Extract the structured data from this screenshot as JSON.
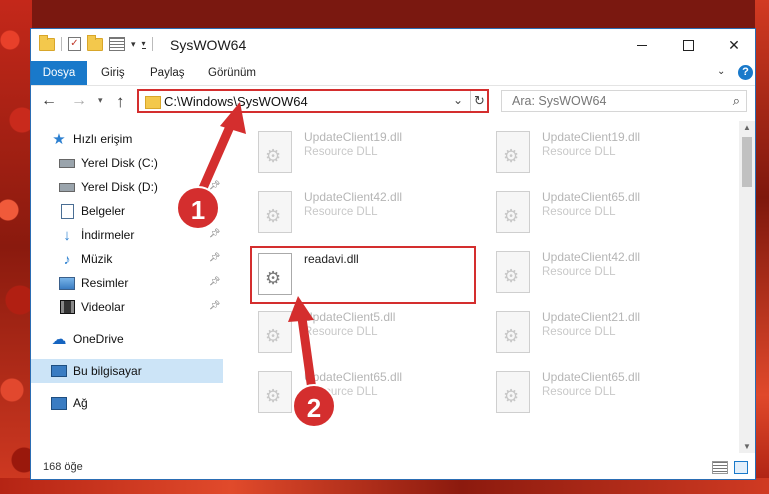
{
  "window": {
    "title": "SysWOW64",
    "ribbon_tabs": [
      "Dosya",
      "Giriş",
      "Paylaş",
      "Görünüm"
    ],
    "help": "?"
  },
  "address": {
    "path": "C:\\Windows\\SysWOW64",
    "search_placeholder": "Ara: SysWOW64"
  },
  "nav": {
    "items": [
      {
        "label": "Hızlı erişim",
        "icon": "star-icon",
        "pinned": false
      },
      {
        "label": "Yerel Disk (C:)",
        "icon": "drive-icon",
        "pinned": true
      },
      {
        "label": "Yerel Disk (D:)",
        "icon": "drive-icon",
        "pinned": true
      },
      {
        "label": "Belgeler",
        "icon": "documents-icon",
        "pinned": true
      },
      {
        "label": "İndirmeler",
        "icon": "downloads-icon",
        "pinned": true
      },
      {
        "label": "Müzik",
        "icon": "music-icon",
        "pinned": true
      },
      {
        "label": "Resimler",
        "icon": "pictures-icon",
        "pinned": true
      },
      {
        "label": "Videolar",
        "icon": "videos-icon",
        "pinned": true
      },
      {
        "label": "OneDrive",
        "icon": "onedrive-icon",
        "pinned": false
      },
      {
        "label": "Bu bilgisayar",
        "icon": "this-pc-icon",
        "pinned": false
      },
      {
        "label": "Ağ",
        "icon": "network-icon",
        "pinned": false
      }
    ]
  },
  "files": [
    {
      "name": "UpdateClient19.dll",
      "desc": "Resource DLL"
    },
    {
      "name": "UpdateClient19.dll",
      "desc": "Resource DLL"
    },
    {
      "name": "UpdateClient42.dll",
      "desc": "Resource DLL"
    },
    {
      "name": "UpdateClient65.dll",
      "desc": "Resource DLL"
    },
    {
      "name": "readavi.dll",
      "desc": ""
    },
    {
      "name": "UpdateClient42.dll",
      "desc": "Resource DLL"
    },
    {
      "name": "UpdateClient5.dll",
      "desc": "Resource DLL"
    },
    {
      "name": "UpdateClient21.dll",
      "desc": "Resource DLL"
    },
    {
      "name": "UpdateClient65.dll",
      "desc": "Resource DLL"
    },
    {
      "name": "UpdateClient65.dll",
      "desc": "Resource DLL"
    }
  ],
  "status": {
    "item_count": "168 öğe"
  },
  "annotations": {
    "step1": "1",
    "step2": "2",
    "color": "#d42e2e"
  }
}
